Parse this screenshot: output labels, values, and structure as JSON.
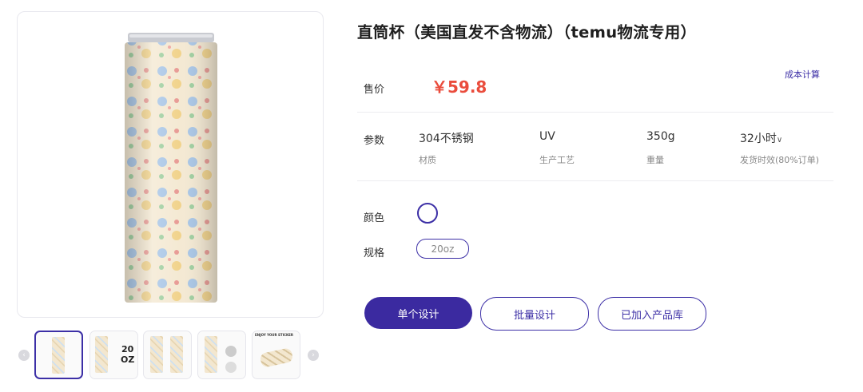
{
  "product": {
    "title": "直筒杯（美国直发不含物流）（temu物流专用）",
    "price_label": "售价",
    "price": "￥59.8",
    "cost_link": "成本计算",
    "params_label": "参数",
    "params": [
      {
        "value": "304不锈钢",
        "key": "材质"
      },
      {
        "value": "UV",
        "key": "生产工艺"
      },
      {
        "value": "350g",
        "key": "重量"
      },
      {
        "value": "32小时",
        "key": "发货时效(80%订单)"
      }
    ],
    "color_label": "颜色",
    "spec_label": "规格",
    "spec_option": "20oz"
  },
  "gallery": {
    "thumb2_text": "20\nOZ",
    "thumb5_caption": "ENJOY YOUR STICKER"
  },
  "buttons": {
    "single_design": "单个设计",
    "batch_design": "批量设计",
    "added_to_library": "已加入产品库"
  },
  "colors": {
    "accent": "#3c2fa6",
    "price": "#ea4c3c"
  },
  "icons": {
    "prev": "chevron-left-icon",
    "next": "chevron-right-icon",
    "dropdown": "chevron-down-icon"
  }
}
